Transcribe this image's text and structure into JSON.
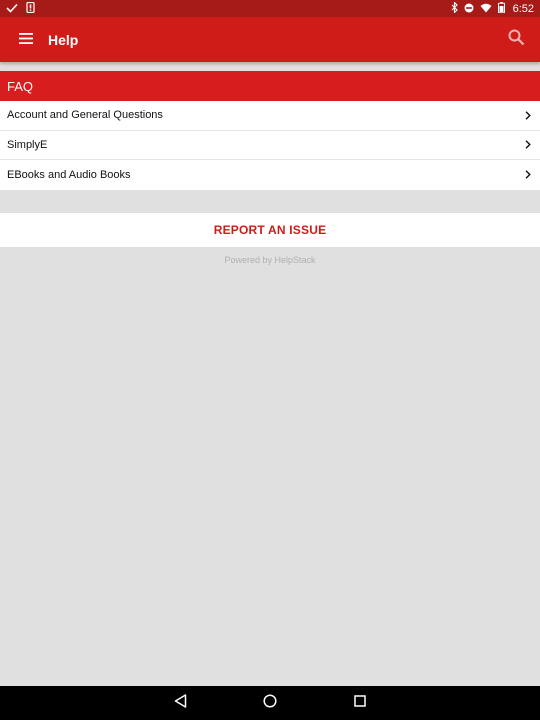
{
  "status_bar": {
    "time": "6:52",
    "icons_left": [
      "check-icon",
      "phone-notification-icon"
    ],
    "icons_right": [
      "bluetooth-icon",
      "do-not-disturb-icon",
      "wifi-icon",
      "battery-icon"
    ]
  },
  "app_bar": {
    "title": "Help",
    "menu_icon": "hamburger-menu-icon",
    "search_icon": "search-icon",
    "color": "#cf1c18"
  },
  "faq": {
    "header": "FAQ",
    "items": [
      {
        "label": "Account and General Questions"
      },
      {
        "label": "SimplyE"
      },
      {
        "label": "EBooks and Audio Books"
      }
    ]
  },
  "report": {
    "label": "REPORT AN ISSUE"
  },
  "footer": {
    "powered_by": "Powered by HelpStack"
  },
  "nav_bar": {
    "icons": [
      "back-icon",
      "home-icon",
      "recents-icon"
    ]
  }
}
